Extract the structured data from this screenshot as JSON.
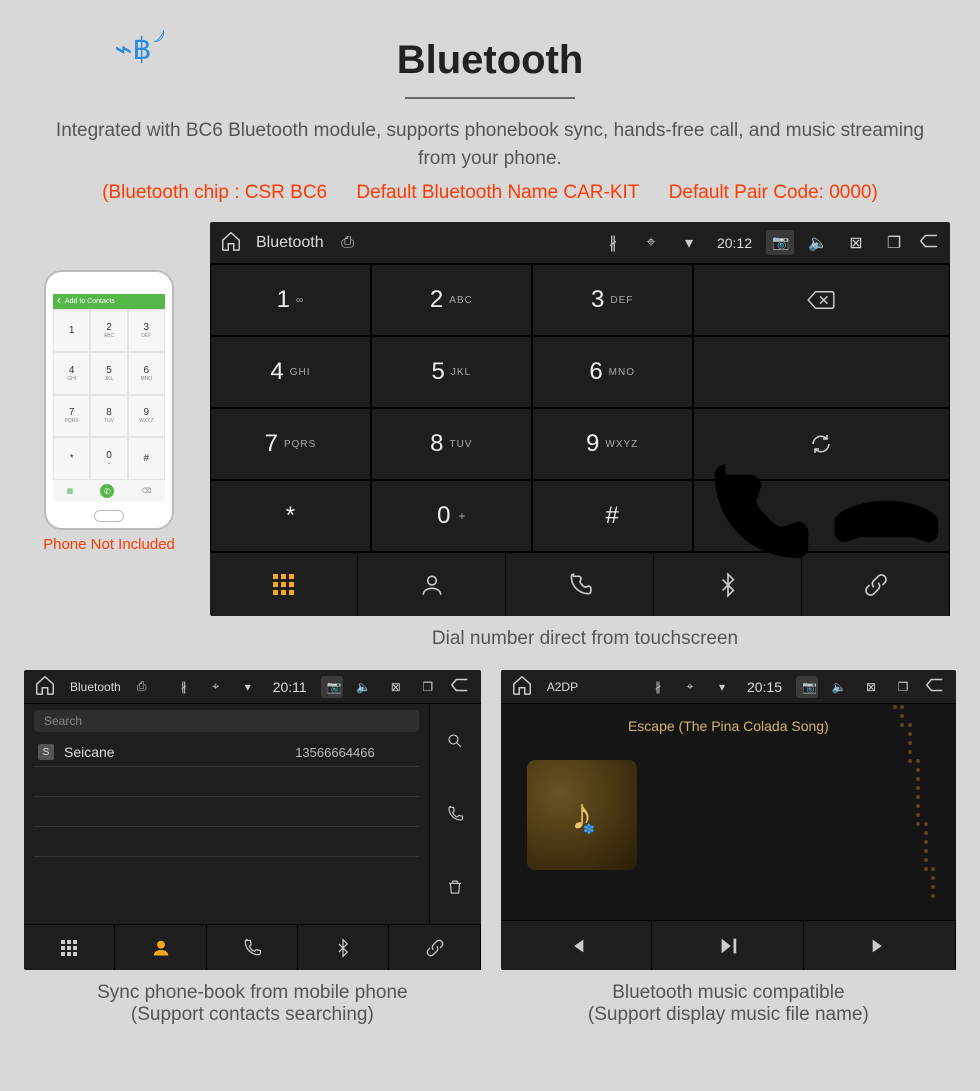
{
  "title": "Bluetooth",
  "lead": "Integrated with BC6 Bluetooth module, supports phonebook sync, hands-free call, and music streaming from your phone.",
  "spec": {
    "chip": "(Bluetooth chip : CSR BC6",
    "name": "Default Bluetooth Name CAR-KIT",
    "pair": "Default Pair Code: 0000)"
  },
  "phone": {
    "topbar": "Add to Contacts",
    "keys": [
      {
        "n": "1",
        "s": ""
      },
      {
        "n": "2",
        "s": "ABC"
      },
      {
        "n": "3",
        "s": "DEF"
      },
      {
        "n": "4",
        "s": "GHI"
      },
      {
        "n": "5",
        "s": "JKL"
      },
      {
        "n": "6",
        "s": "MNO"
      },
      {
        "n": "7",
        "s": "PQRS"
      },
      {
        "n": "8",
        "s": "TUV"
      },
      {
        "n": "9",
        "s": "WXYZ"
      },
      {
        "n": "*",
        "s": ""
      },
      {
        "n": "0",
        "s": "+"
      },
      {
        "n": "#",
        "s": ""
      }
    ],
    "note": "Phone Not Included"
  },
  "dialer": {
    "sb": {
      "title": "Bluetooth",
      "time": "20:12"
    },
    "keys": [
      {
        "n": "1",
        "s": "∞"
      },
      {
        "n": "2",
        "s": "ABC"
      },
      {
        "n": "3",
        "s": "DEF"
      },
      {
        "n": "4",
        "s": "GHI"
      },
      {
        "n": "5",
        "s": "JKL"
      },
      {
        "n": "6",
        "s": "MNO"
      },
      {
        "n": "7",
        "s": "PQRS"
      },
      {
        "n": "8",
        "s": "TUV"
      },
      {
        "n": "9",
        "s": "WXYZ"
      },
      {
        "n": "*",
        "s": ""
      },
      {
        "n": "0",
        "s": "+",
        "sup": "+"
      },
      {
        "n": "#",
        "s": ""
      }
    ],
    "caption": "Dial number direct from touchscreen"
  },
  "contacts": {
    "sb": {
      "title": "Bluetooth",
      "time": "20:11"
    },
    "search_ph": "Search",
    "row": {
      "badge": "S",
      "name": "Seicane",
      "num": "13566664466"
    },
    "caption1": "Sync phone-book from mobile phone",
    "caption2": "(Support contacts searching)"
  },
  "a2dp": {
    "sb": {
      "title": "A2DP",
      "time": "20:15"
    },
    "track": "Escape (The Pina Colada Song)",
    "caption1": "Bluetooth music compatible",
    "caption2": "(Support display music file name)"
  }
}
